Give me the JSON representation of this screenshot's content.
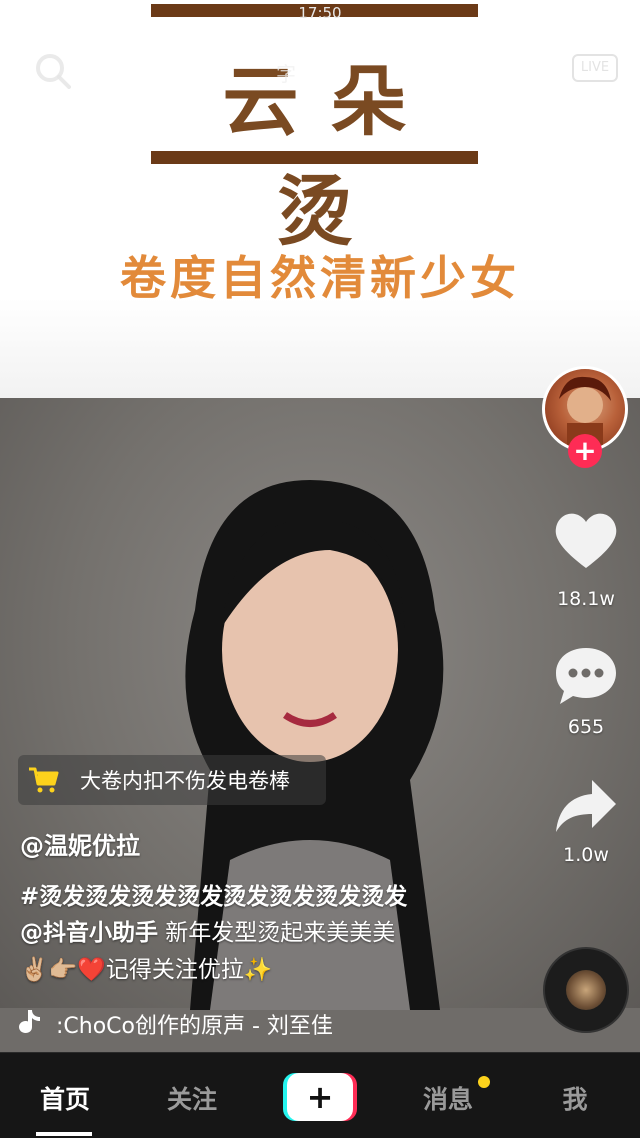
{
  "status": {
    "time": "17:50",
    "left": ""
  },
  "top": {
    "label": "字",
    "live": "LIVE"
  },
  "banner": {
    "title": "云朵烫",
    "subtitle": "卷度自然清新少女"
  },
  "rail": {
    "like_count": "18.1w",
    "comment_count": "655",
    "share_count": "1.0w",
    "follow_symbol": "+"
  },
  "product": {
    "label": "大卷内扣不伤发电卷棒"
  },
  "caption": {
    "author": "@温妮优拉",
    "hashtags": "#烫发烫发烫发烫发烫发烫发烫发烫发",
    "mention": "@抖音小助手",
    "line2_text": " 新年发型烫起来美美美",
    "emojis": "✌🏼👉🏼❤️",
    "line3_text": "记得关注优拉",
    "sparkle": "✨"
  },
  "music": {
    "text": ":ChoCo创作的原声 - 刘至佳"
  },
  "nav": {
    "home": "首页",
    "follow": "关注",
    "add": "+",
    "messages": "消息",
    "me": "我"
  },
  "colors": {
    "accent_red": "#fe2c55",
    "accent_cyan": "#25f4ee",
    "badge_yellow": "#fcd21c",
    "banner_brown": "#6b3a17",
    "banner_orange": "#e28a3a"
  },
  "icons": [
    "search-icon",
    "heart-icon",
    "comment-icon",
    "share-icon",
    "cart-icon",
    "music-note-icon",
    "plus-icon"
  ]
}
